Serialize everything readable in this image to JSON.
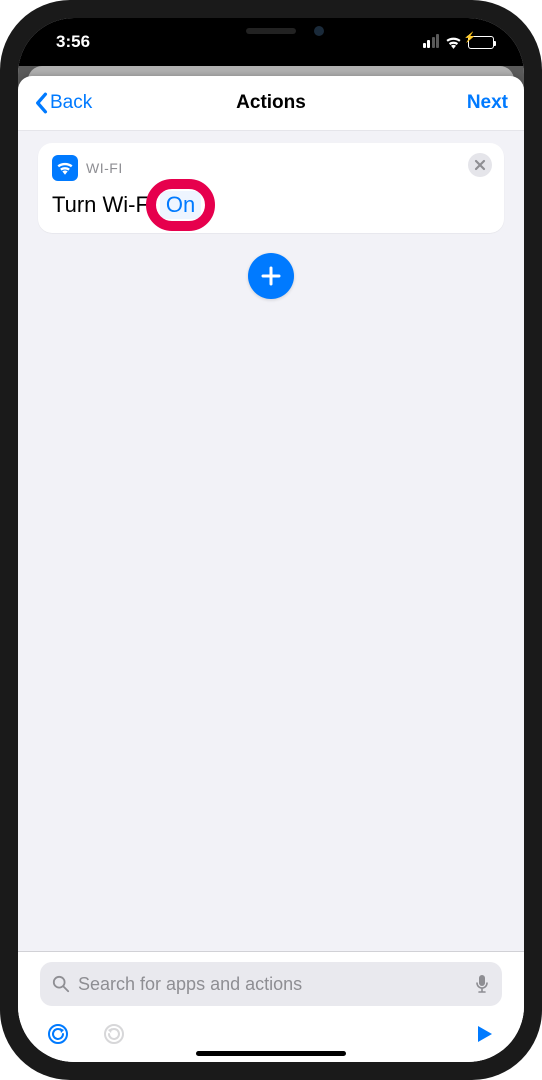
{
  "status": {
    "time": "3:56"
  },
  "nav": {
    "back_label": "Back",
    "title": "Actions",
    "next_label": "Next"
  },
  "action": {
    "category": "WI-FI",
    "prefix": "Turn Wi-Fi",
    "param_value": "On"
  },
  "search": {
    "placeholder": "Search for apps and actions"
  },
  "colors": {
    "accent": "#007aff",
    "highlight": "#e6004d",
    "battery_fill": "#34c759"
  }
}
